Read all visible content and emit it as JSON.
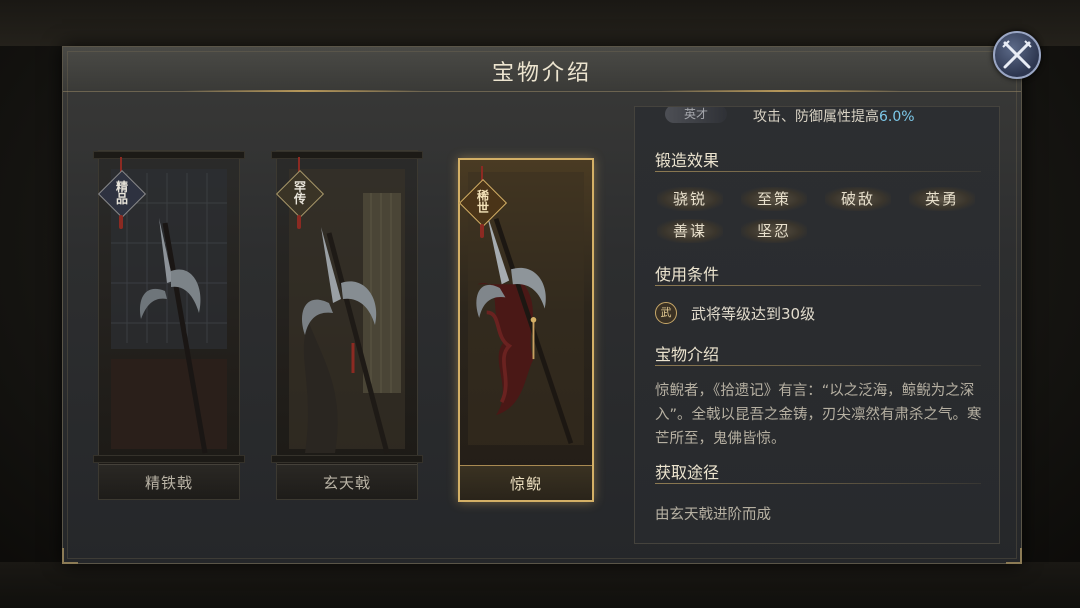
{
  "dialog": {
    "title": "宝物介绍"
  },
  "close_icon": "crossed-swords-close-icon",
  "weapons": [
    {
      "name": "精铁戟",
      "tag": [
        "精",
        "品"
      ],
      "selected": false
    },
    {
      "name": "玄天戟",
      "tag": [
        "罕",
        "传"
      ],
      "selected": false
    },
    {
      "name": "惊鲵",
      "tag": [
        "稀",
        "世"
      ],
      "selected": true
    }
  ],
  "info": {
    "top_row": {
      "badge": "英才",
      "text": "攻击、防御属性提高",
      "value": "6.0%"
    },
    "forge": {
      "title": "锻造效果",
      "effects": [
        "骁锐",
        "至策",
        "破敌",
        "英勇",
        "善谋",
        "坚忍"
      ]
    },
    "condition": {
      "title": "使用条件",
      "icon_text": "武",
      "text": "武将等级达到30级"
    },
    "intro": {
      "title": "宝物介绍",
      "text": "惊鲵者，《拾遗记》有言：“以之泛海，鲸鲵为之深入”。全戟以昆吾之金铸，刃尖凛然有肃杀之气。寒芒所至，鬼佛皆惊。"
    },
    "source": {
      "title": "获取途径",
      "text": "由玄天戟进阶而成"
    }
  },
  "colors": {
    "accent_gold": "#d4b066",
    "highlight_blue": "#7cc8e8"
  }
}
